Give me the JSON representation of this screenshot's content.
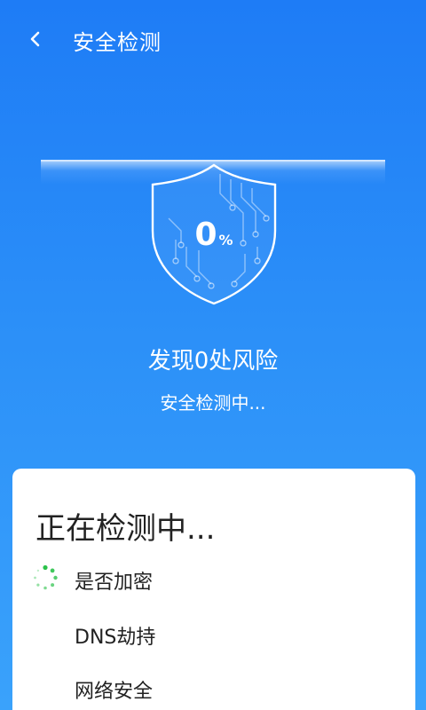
{
  "header": {
    "title": "安全检测",
    "back_icon": "back-arrow-icon"
  },
  "scan": {
    "percent": "0",
    "percent_unit": "%",
    "progress": 0,
    "risk_summary": "发现0处风险",
    "status": "安全检测中..."
  },
  "checklist": {
    "title": "正在检测中...",
    "items": [
      {
        "label": "是否加密",
        "state": "scanning"
      },
      {
        "label": "DNS劫持",
        "state": "pending"
      },
      {
        "label": "网络安全",
        "state": "pending"
      }
    ]
  },
  "colors": {
    "background_top": "#1e7cf6",
    "background_bottom": "#3aa2fb",
    "spinner_green": "#2bc24a",
    "card_bg": "#ffffff"
  }
}
